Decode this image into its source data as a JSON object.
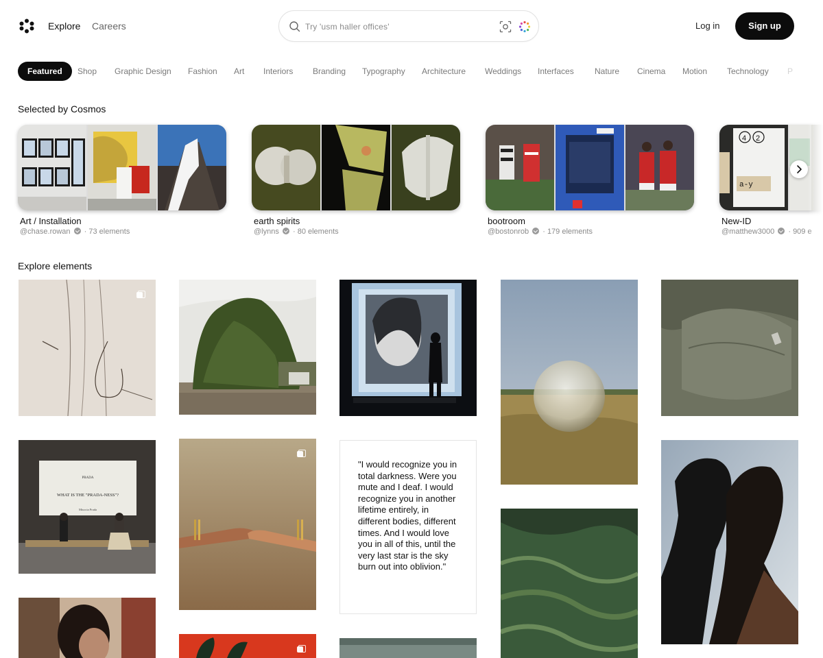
{
  "header": {
    "nav": {
      "explore": "Explore",
      "careers": "Careers"
    },
    "search": {
      "placeholder": "Try 'usm haller offices'"
    },
    "login": "Log in",
    "signup": "Sign up"
  },
  "categories": [
    "Featured",
    "Shop",
    "Graphic Design",
    "Fashion",
    "Art",
    "Interiors",
    "Branding",
    "Typography",
    "Architecture",
    "Weddings",
    "Interfaces",
    "Nature",
    "Cinema",
    "Motion",
    "Technology",
    "P"
  ],
  "active_category": "Featured",
  "selected": {
    "title": "Selected by Cosmos",
    "collections": [
      {
        "title": "Art / Installation",
        "user": "@chase.rowan",
        "count": "· 73 elements"
      },
      {
        "title": "earth spirits",
        "user": "@lynns",
        "count": "· 80 elements"
      },
      {
        "title": "bootroom",
        "user": "@bostonrob",
        "count": "· 179 elements"
      },
      {
        "title": "New-ID",
        "user": "@matthew3000",
        "count": "· 909 e"
      }
    ]
  },
  "explore": {
    "title": "Explore elements",
    "quote": "\"I would recognize you in total darkness. Were you mute and I deaf. I would recognize you in another lifetime entirely, in different bodies, different times. And I would love you in all of this, until the very last star is the sky burn out into oblivion.\"",
    "prada_screen": {
      "brand": "PRADA",
      "headline": "WHAT IS THE \"PRADA-NESS\"?",
      "sub": "Miuccia Prada"
    }
  },
  "icons": {
    "logo": "cosmos-logo-icon",
    "search": "search-icon",
    "lens": "visual-search-icon",
    "color": "color-search-icon",
    "verified": "verified-badge-icon",
    "next": "chevron-right-icon",
    "multi": "multiple-images-icon"
  },
  "colors": {
    "accent": "#0c0c0c",
    "muted": "#7a7a7a"
  }
}
